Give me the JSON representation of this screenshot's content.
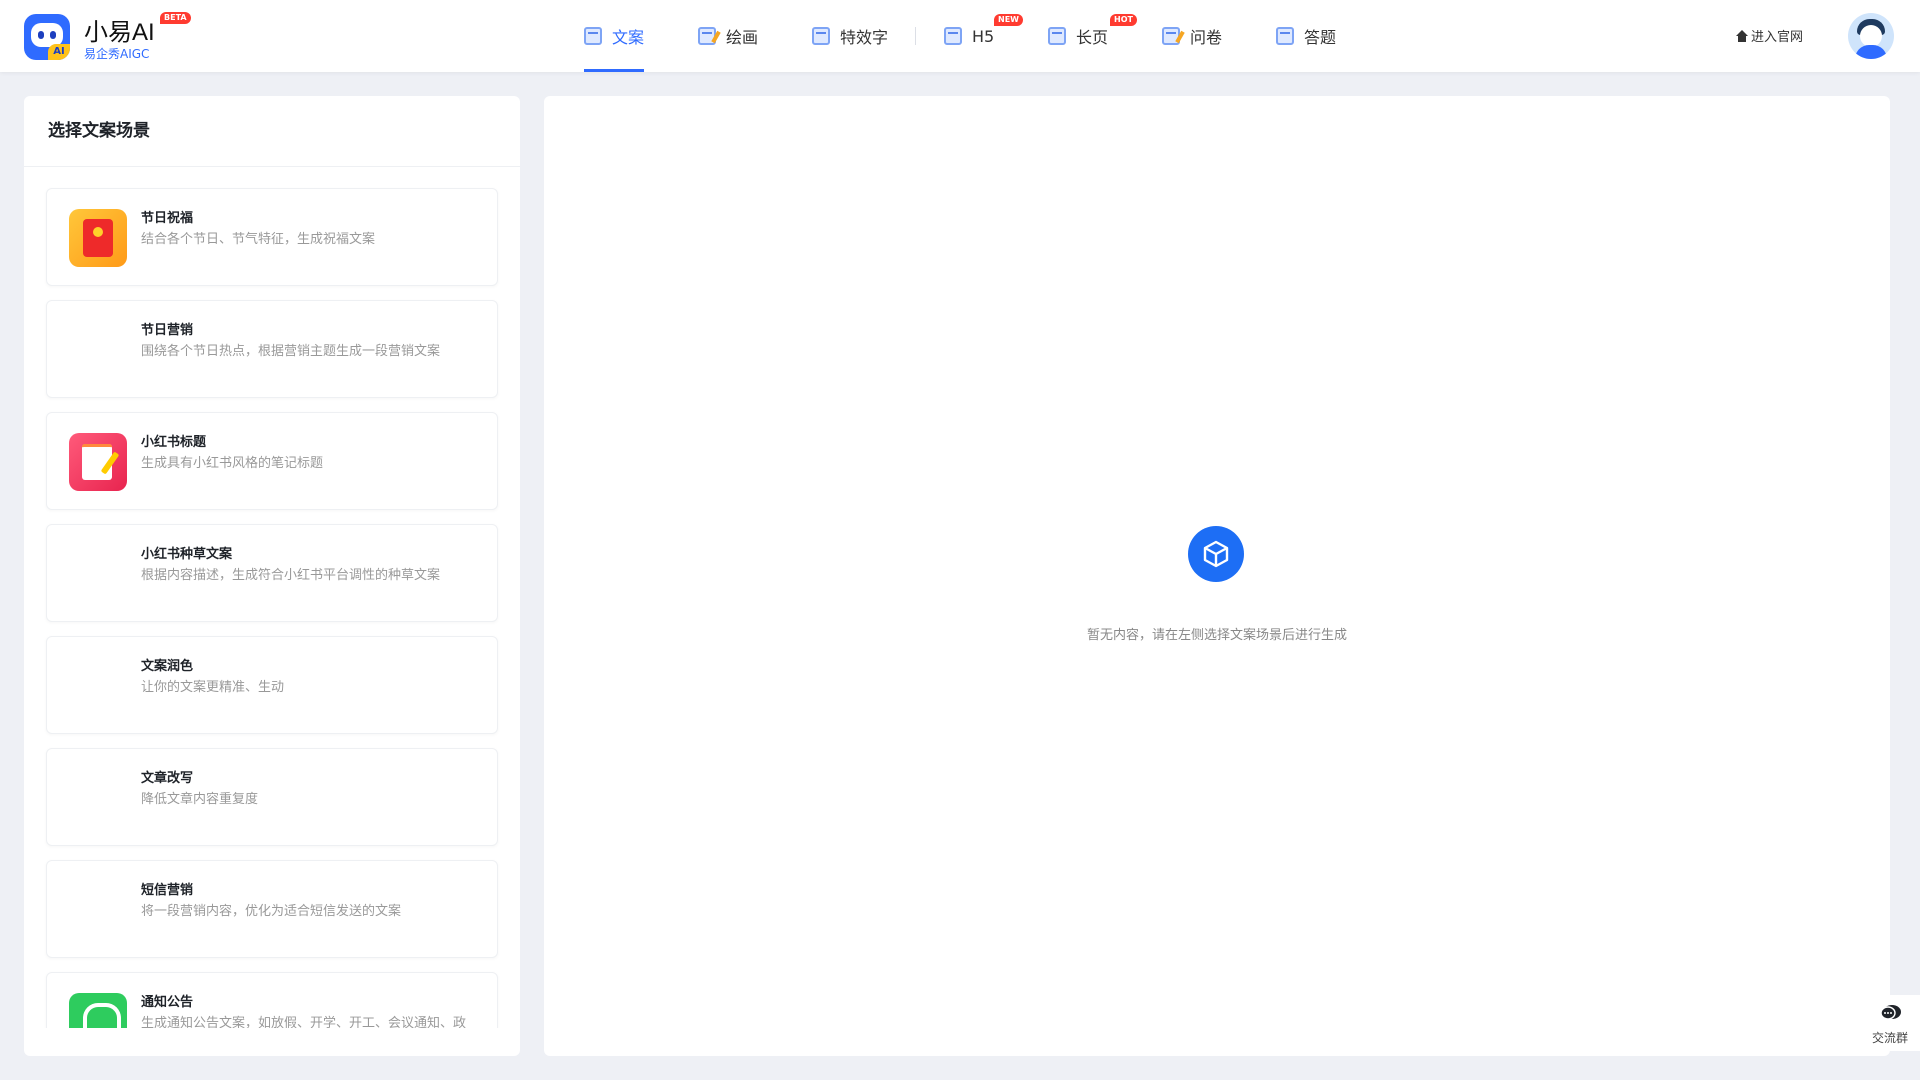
{
  "brand": {
    "name": "小易AI",
    "badge": "BETA",
    "logo_tag": "AI",
    "subtitle": "易企秀AIGC"
  },
  "nav": {
    "items": [
      {
        "label": "文案",
        "active": true
      },
      {
        "label": "绘画"
      },
      {
        "label": "特效字"
      },
      {
        "label": "H5",
        "badge": "NEW"
      },
      {
        "label": "长页",
        "badge": "HOT"
      },
      {
        "label": "问卷"
      },
      {
        "label": "答题"
      }
    ]
  },
  "header": {
    "home_link": "进入官网"
  },
  "sidebar": {
    "title": "选择文案场景",
    "scenes": [
      {
        "title": "节日祝福",
        "desc": "结合各个节日、节气特征，生成祝福文案",
        "icon": "red-envelope-icon"
      },
      {
        "title": "节日营销",
        "desc": "围绕各个节日热点，根据营销主题生成一段营销文案",
        "icon": ""
      },
      {
        "title": "小红书标题",
        "desc": "生成具有小红书风格的笔记标题",
        "icon": "note-pencil-icon"
      },
      {
        "title": "小红书种草文案",
        "desc": "根据内容描述，生成符合小红书平台调性的种草文案",
        "icon": ""
      },
      {
        "title": "文案润色",
        "desc": "让你的文案更精准、生动",
        "icon": ""
      },
      {
        "title": "文章改写",
        "desc": "降低文章内容重复度",
        "icon": ""
      },
      {
        "title": "短信营销",
        "desc": "将一段营销内容，优化为适合短信发送的文案",
        "icon": ""
      },
      {
        "title": "通知公告",
        "desc": "生成通知公告文案，如放假、开学、开工、会议通知、政",
        "icon": "bell-icon"
      }
    ]
  },
  "main": {
    "empty_text": "暂无内容，请在左侧选择文案场景后进行生成",
    "empty_icon": "cube-icon"
  },
  "float": {
    "chat_label": "交流群"
  },
  "colors": {
    "accent": "#2f6bff",
    "badge": "#ff3b30",
    "background": "#eef0f5"
  }
}
